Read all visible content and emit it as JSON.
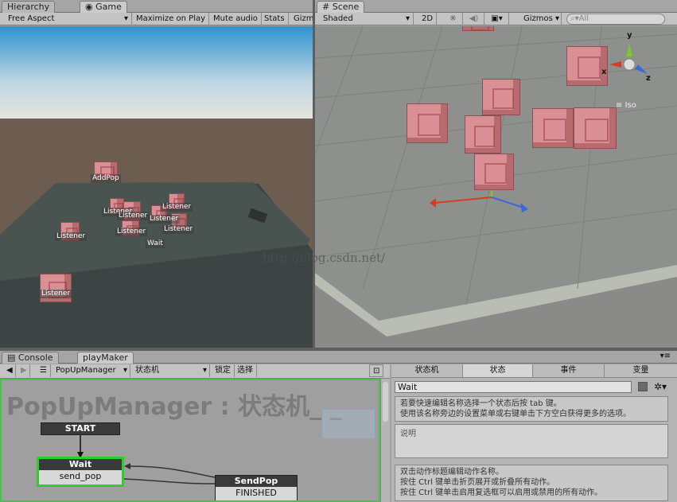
{
  "game_panel": {
    "tabs": [
      {
        "label": "Hierarchy"
      },
      {
        "label": "Game"
      }
    ],
    "toolbar": {
      "aspect": "Free Aspect",
      "maximize": "Maximize on Play",
      "mute": "Mute audio",
      "stats": "Stats",
      "gizmos": "Gizm"
    },
    "labels": {
      "addpop": "AddPop",
      "l1": "Listener",
      "l2": "Listener",
      "l3": "Listener",
      "l4": "Listener",
      "l5": "Listener",
      "l6": "Listener",
      "l7": "Listener",
      "l8": "Listener",
      "wait": "Wait"
    }
  },
  "scene_panel": {
    "tab": "Scene",
    "toolbar": {
      "shading": "Shaded",
      "mode2d": "2D",
      "gizmos": "Gizmos",
      "search_placeholder": "All"
    },
    "axis": {
      "x": "x",
      "y": "y",
      "z": "z",
      "iso": "Iso"
    },
    "watermark": "http://blog.csdn.net/"
  },
  "bottom_tabs": [
    {
      "label": "Console"
    },
    {
      "label": "playMaker"
    }
  ],
  "playmaker": {
    "fsm_owner": "PopUpManager",
    "fsm_name": "状态机",
    "lock_label": "锁定",
    "select_label": "选择",
    "title": "PopUpManager : 状态机_ _",
    "start_label": "START",
    "wait_state": {
      "name": "Wait",
      "event": "send_pop"
    },
    "sendpop_state": {
      "name": "SendPop",
      "event": "FINISHED"
    }
  },
  "inspector": {
    "tabs": [
      {
        "label": "状态机"
      },
      {
        "label": "状态"
      },
      {
        "label": "事件"
      },
      {
        "label": "变量"
      }
    ],
    "state_name": "Wait",
    "hint1": "若要快速编辑名称选择一个状态后按 tab 键。",
    "hint2": "使用该名称旁边的设置菜单或右键单击下方空白获得更多的选项。",
    "description_placeholder": "说明",
    "actions_hint1": "双击动作标题编辑动作名称。",
    "actions_hint2": "按住 Ctrl 键单击折页展开或折叠所有动作。",
    "actions_hint3": "按住 Ctrl 键单击启用复选框可以启用或禁用的所有动作。"
  },
  "colors": {
    "selected_state": "#2ecc2e",
    "state_header": "#3a3a3a"
  }
}
